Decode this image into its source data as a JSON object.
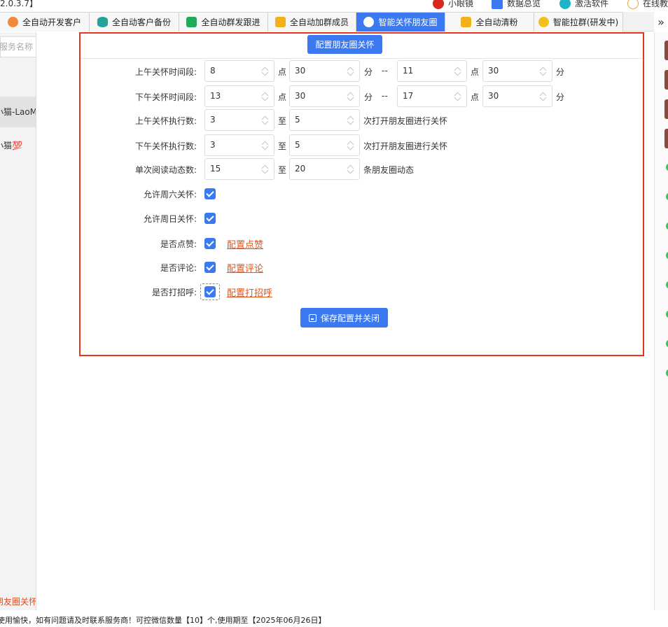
{
  "window": {
    "version": "2.0.3.7】"
  },
  "top_links": [
    {
      "label": "小眼镜",
      "icon": "glasses-icon",
      "color": "#d8281e"
    },
    {
      "label": "数据总览",
      "icon": "document-icon",
      "color": "#3a79f0"
    },
    {
      "label": "激活软件",
      "icon": "shield-icon",
      "color": "#1fb3c8"
    },
    {
      "label": "在线教",
      "icon": "help-icon",
      "color": "#e9a43b"
    }
  ],
  "tabs": [
    {
      "label": "全自动开发客户",
      "icon": "user-circle-icon",
      "color": "#f08a3a"
    },
    {
      "label": "全自动客户备份",
      "icon": "database-icon",
      "color": "#22a49a"
    },
    {
      "label": "全自动群发跟进",
      "icon": "chat-icon",
      "color": "#22a95a"
    },
    {
      "label": "全自动加群成员",
      "icon": "contact-icon",
      "color": "#f2b11a"
    },
    {
      "label": "智能关怀朋友圈",
      "icon": "moments-icon",
      "color": "#ffffff"
    },
    {
      "label": "全自动清粉",
      "icon": "broom-icon",
      "color": "#f2b11a"
    },
    {
      "label": "智能拉群(研发中)",
      "icon": "coin-icon",
      "color": "#f2c21a"
    }
  ],
  "tab_more": "»",
  "left": {
    "search_placeholder": "服务名称",
    "rows": [
      "",
      "小猫-LaoMao",
      "小猫💯"
    ],
    "bottom": "朋友圈关怀 ("
  },
  "form": {
    "title": "配置朋友圈关怀",
    "rows": {
      "am_time": {
        "label": "上午关怀时间段:",
        "start_h": "8",
        "start_m": "30",
        "end_h": "11",
        "end_m": "30"
      },
      "pm_time": {
        "label": "下午关怀时间段:",
        "start_h": "13",
        "start_m": "30",
        "end_h": "17",
        "end_m": "30"
      },
      "am_count": {
        "label": "上午关怀执行数:",
        "min": "3",
        "max": "5",
        "suffix": "次打开朋友圈进行关怀"
      },
      "pm_count": {
        "label": "下午关怀执行数:",
        "min": "3",
        "max": "5",
        "suffix": "次打开朋友圈进行关怀"
      },
      "read_count": {
        "label": "单次阅读动态数:",
        "min": "15",
        "max": "20",
        "suffix": "条朋友圈动态"
      }
    },
    "units": {
      "hour": "点",
      "minute": "分",
      "range_sep": "--",
      "to": "至"
    },
    "checks": {
      "saturday": {
        "label": "允许周六关怀:",
        "checked": true
      },
      "sunday": {
        "label": "允许周日关怀:",
        "checked": true
      },
      "like": {
        "label": "是否点赞:",
        "checked": true,
        "link": "配置点赞"
      },
      "comment": {
        "label": "是否评论:",
        "checked": true,
        "link": "配置评论"
      },
      "greet": {
        "label": "是否打招呼:",
        "checked": true,
        "link": "配置打招呼"
      }
    },
    "save_label": "保存配置并关闭"
  },
  "status_text": "使用愉快，如有问题请及时联系服务商！可控微信数量【10】个,使用期至【2025年06月26日】",
  "colors": {
    "accent": "#3a79f0",
    "frame": "#e8351e",
    "link": "#e0561e"
  }
}
